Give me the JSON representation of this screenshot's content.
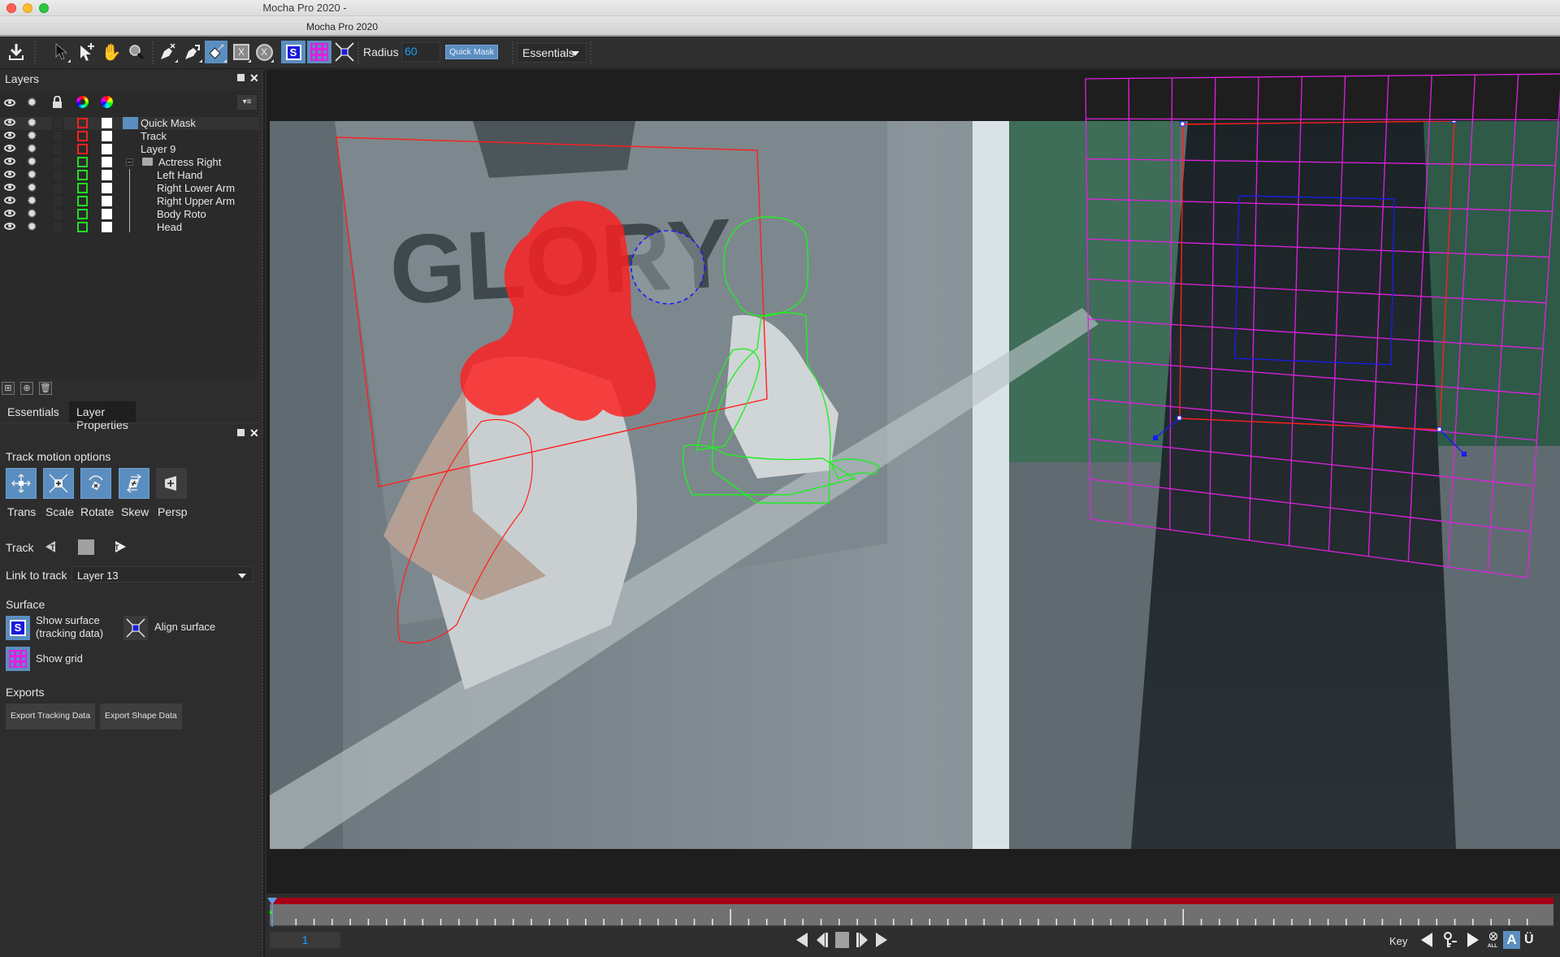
{
  "window": {
    "title": "Mocha Pro 2020 -",
    "subtitle": "Mocha Pro 2020"
  },
  "toolbar": {
    "tools": [
      {
        "name": "save-ae-data",
        "icon": "download-icon"
      },
      {
        "name": "pick",
        "icon": "arrow-pointer-icon"
      },
      {
        "name": "add-point",
        "icon": "add-point-icon"
      },
      {
        "name": "pan",
        "icon": "hand-icon"
      },
      {
        "name": "zoom",
        "icon": "magnifier-icon"
      },
      {
        "name": "x-spline-pen",
        "icon": "pen-x-icon"
      },
      {
        "name": "magnetic-pen",
        "icon": "pen-magnet-icon"
      },
      {
        "name": "quick-mask-brush",
        "icon": "brush-icon",
        "active": true
      },
      {
        "name": "rect-x",
        "icon": "rect-x-icon"
      },
      {
        "name": "circle-x",
        "icon": "circle-x-icon"
      },
      {
        "name": "show-surface",
        "icon": "surface-s-icon",
        "active": true
      },
      {
        "name": "show-grid",
        "icon": "grid-icon",
        "active": true
      },
      {
        "name": "align-surface",
        "icon": "align-surface-icon"
      }
    ],
    "radius_label": "Radius",
    "radius_value": "60",
    "quick_mask_label": "Quick Mask",
    "workspace": "Essentials"
  },
  "layers_panel": {
    "title": "Layers",
    "header_icons": [
      "eye-icon",
      "gear-icon",
      "lock-icon",
      "color-ring-icon",
      "color-wheel-icon"
    ],
    "layers": [
      {
        "name": "Quick Mask",
        "color": "#ff2020",
        "selected": true,
        "indent": 0
      },
      {
        "name": "Track",
        "color": "#ff2020",
        "indent": 0
      },
      {
        "name": "Layer 9",
        "color": "#ff2020",
        "indent": 0
      },
      {
        "name": "Actress Right",
        "color": "#22dd22",
        "indent": 0,
        "group": true,
        "expanded": true
      },
      {
        "name": "Left Hand",
        "color": "#22dd22",
        "indent": 1
      },
      {
        "name": "Right Lower Arm",
        "color": "#22dd22",
        "indent": 1
      },
      {
        "name": "Right Upper Arm",
        "color": "#22dd22",
        "indent": 1
      },
      {
        "name": "Body Roto",
        "color": "#22dd22",
        "indent": 1
      },
      {
        "name": "Head",
        "color": "#22dd22",
        "indent": 1
      }
    ],
    "bottom_buttons": [
      "new-group-icon",
      "new-layer-icon",
      "trash-icon"
    ]
  },
  "properties_panel": {
    "tabs": [
      {
        "label": "Essentials",
        "active": false
      },
      {
        "label": "Layer Properties",
        "active": true
      }
    ],
    "track_motion": {
      "title": "Track motion options",
      "options": [
        {
          "label": "Trans",
          "on": true
        },
        {
          "label": "Scale",
          "on": true
        },
        {
          "label": "Rotate",
          "on": true
        },
        {
          "label": "Skew",
          "on": true
        },
        {
          "label": "Persp",
          "on": false
        }
      ]
    },
    "track_label": "Track",
    "link_to_track_label": "Link to track",
    "link_to_track_value": "Layer 13",
    "surface": {
      "title": "Surface",
      "show_surface": "Show surface",
      "show_surface_sub": "(tracking data)",
      "align_surface": "Align surface",
      "show_grid": "Show grid"
    },
    "exports": {
      "title": "Exports",
      "export_tracking": "Export Tracking Data",
      "export_shape": "Export Shape Data"
    }
  },
  "viewer": {
    "sign_text": "GLORY",
    "colors": {
      "mask_red": "#ff1f1f",
      "roto_green": "#22ee22",
      "grid_magenta": "#e020e0",
      "surface_blue": "#1a1aff"
    }
  },
  "timeline": {
    "current_frame": "1",
    "key_label": "Key",
    "in_out_color": "#a50016",
    "playhead_color": "#5aa0e6"
  }
}
